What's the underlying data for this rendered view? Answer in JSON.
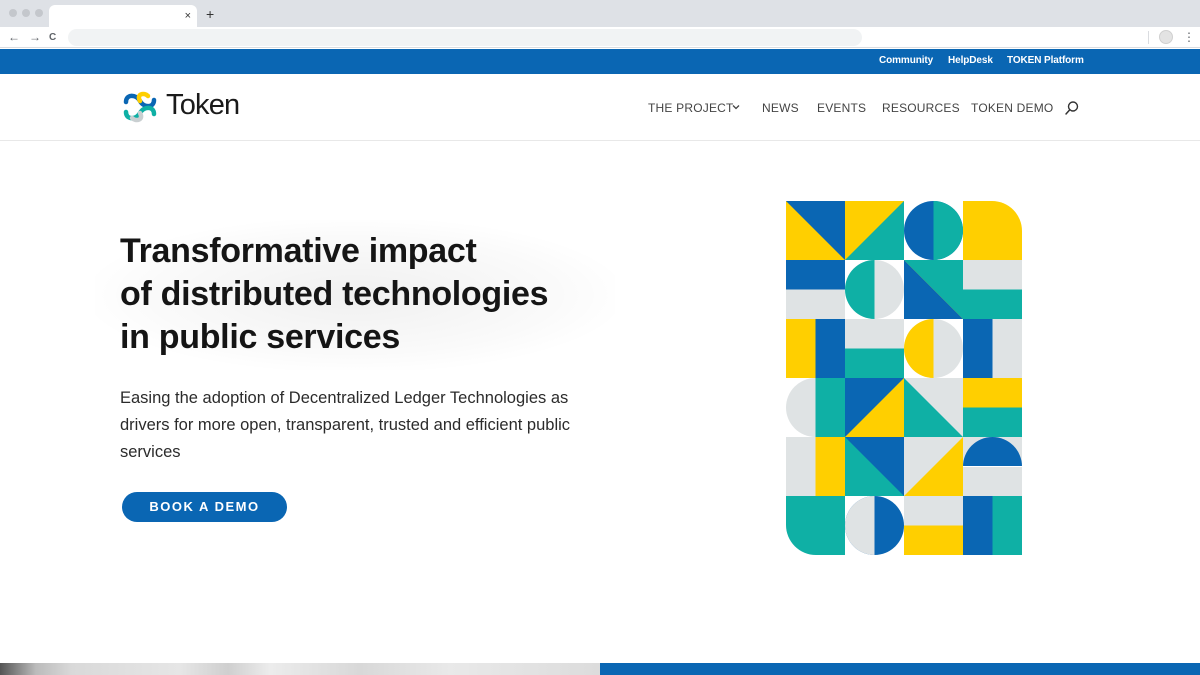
{
  "browser": {
    "tab_close": "×",
    "new_tab": "+",
    "back": "←",
    "forward": "→",
    "reload": "C",
    "menu": "⋮"
  },
  "topbar": {
    "links": [
      "Community",
      "HelpDesk",
      "TOKEN Platform"
    ],
    "background": "#0a66b3"
  },
  "header": {
    "logo_text": "Token",
    "nav": [
      "THE PROJECT",
      "NEWS",
      "EVENTS",
      "RESOURCES",
      "TOKEN DEMO"
    ],
    "icons": [
      "chevron-down-icon",
      "search-icon"
    ]
  },
  "hero": {
    "title_lines": [
      "Transformative impact",
      "of distributed technologies",
      "in public services"
    ],
    "subtitle_lines": [
      "Easing the adoption of Decentralized Ledger Technologies as",
      "drivers for more open, transparent, trusted and efficient public",
      "services"
    ],
    "cta": "BOOK A DEMO"
  },
  "colors": {
    "brand_blue": "#0a66b3",
    "yellow": "#ffcf00",
    "teal": "#0fb0a5",
    "grey": "#dfe3e4"
  }
}
